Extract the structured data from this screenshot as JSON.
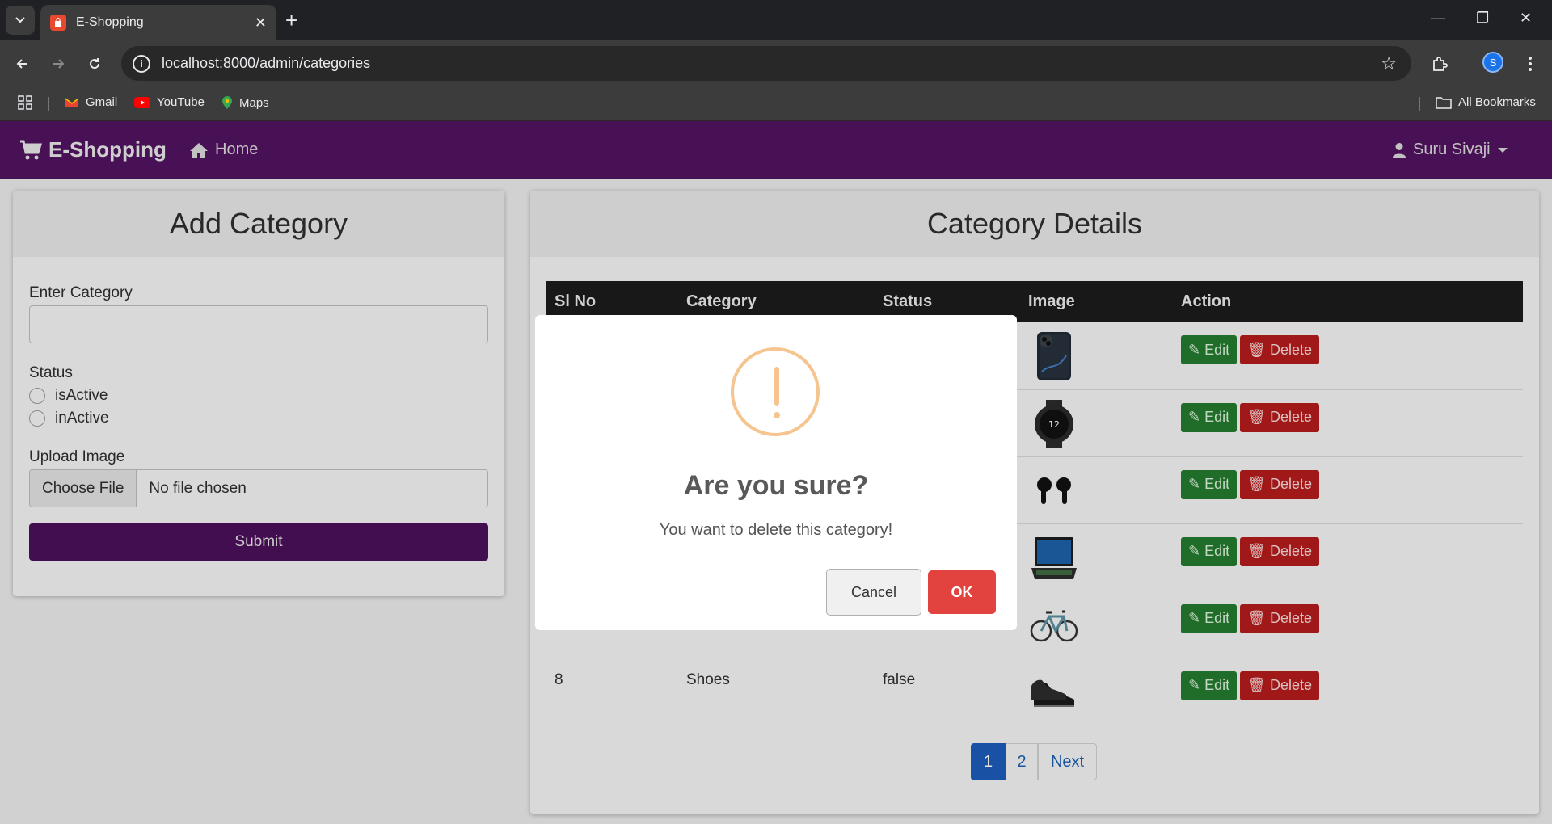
{
  "browser": {
    "tab_title": "E-Shopping",
    "url": "localhost:8000/admin/categories",
    "profile_initial": "S",
    "bookmarks": [
      "Gmail",
      "YouTube",
      "Maps"
    ],
    "all_bookmarks": "All Bookmarks"
  },
  "navbar": {
    "brand": "E-Shopping",
    "home": "Home",
    "user": "Suru Sivaji",
    "bg_color": "#51135f"
  },
  "add_category": {
    "title": "Add Category",
    "enter_label": "Enter Category",
    "enter_value": "",
    "status_label": "Status",
    "radio_active": "isActive",
    "radio_inactive": "inActive",
    "upload_label": "Upload Image",
    "choose_file": "Choose File",
    "no_file": "No file chosen",
    "submit": "Submit"
  },
  "category_details": {
    "title": "Category Details",
    "columns": [
      "Sl No",
      "Category",
      "Status",
      "Image",
      "Action"
    ],
    "rows": [
      {
        "sl": "",
        "category": "",
        "status": "",
        "image": "phone-icon"
      },
      {
        "sl": "",
        "category": "",
        "status": "",
        "image": "watch-icon"
      },
      {
        "sl": "",
        "category": "",
        "status": "",
        "image": "earbuds-icon"
      },
      {
        "sl": "",
        "category": "",
        "status": "",
        "image": "laptop-icon"
      },
      {
        "sl": "",
        "category": "",
        "status": "",
        "image": "bicycle-icon"
      },
      {
        "sl": "8",
        "category": "Shoes",
        "status": "false",
        "image": "shoe-icon"
      }
    ],
    "edit_label": "Edit",
    "delete_label": "Delete",
    "pagination": [
      "1",
      "2",
      "Next"
    ],
    "active_page": "1"
  },
  "modal": {
    "title": "Are you sure?",
    "text": "You want to delete this category!",
    "cancel": "Cancel",
    "ok": "OK",
    "ok_color": "#e2433f"
  }
}
